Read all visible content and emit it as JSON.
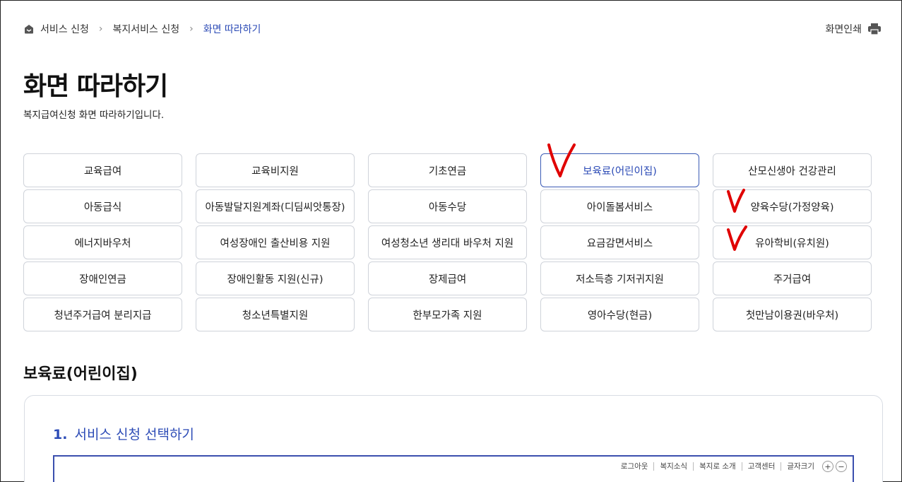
{
  "breadcrumb": {
    "items": [
      "서비스 신청",
      "복지서비스 신청",
      "화면 따라하기"
    ],
    "separator": ">"
  },
  "print": {
    "label": "화면인쇄"
  },
  "page": {
    "title": "화면 따라하기",
    "description": "복지급여신청 화면 따라하기입니다."
  },
  "services": [
    "교육급여",
    "교육비지원",
    "기초연금",
    "보육료(어린이집)",
    "산모신생아 건강관리",
    "아동급식",
    "아동발달지원계좌(디딤씨앗통장)",
    "아동수당",
    "아이돌봄서비스",
    "양육수당(가정양육)",
    "에너지바우처",
    "여성장애인 출산비용 지원",
    "여성청소년 생리대 바우처 지원",
    "요금감면서비스",
    "유아학비(유치원)",
    "장애인연금",
    "장애인활동 지원(신규)",
    "장제급여",
    "저소득층 기저귀지원",
    "주거급여",
    "청년주거급여 분리지급",
    "청소년특별지원",
    "한부모가족 지원",
    "영아수당(현금)",
    "첫만남이용권(바우처)"
  ],
  "selected_service": "보육료(어린이집)",
  "section": {
    "title": "보육료(어린이집)"
  },
  "step": {
    "number": "1.",
    "title": "서비스 신청 선택하기"
  },
  "embedded_nav": {
    "links": [
      "로그아웃",
      "복지소식",
      "복지로 소개",
      "고객센터",
      "글자크기"
    ],
    "zoom_in": "+",
    "zoom_out": "−"
  },
  "colors": {
    "accent": "#2c4bb6",
    "border": "#cfd3da",
    "checkmark": "#e00000"
  }
}
